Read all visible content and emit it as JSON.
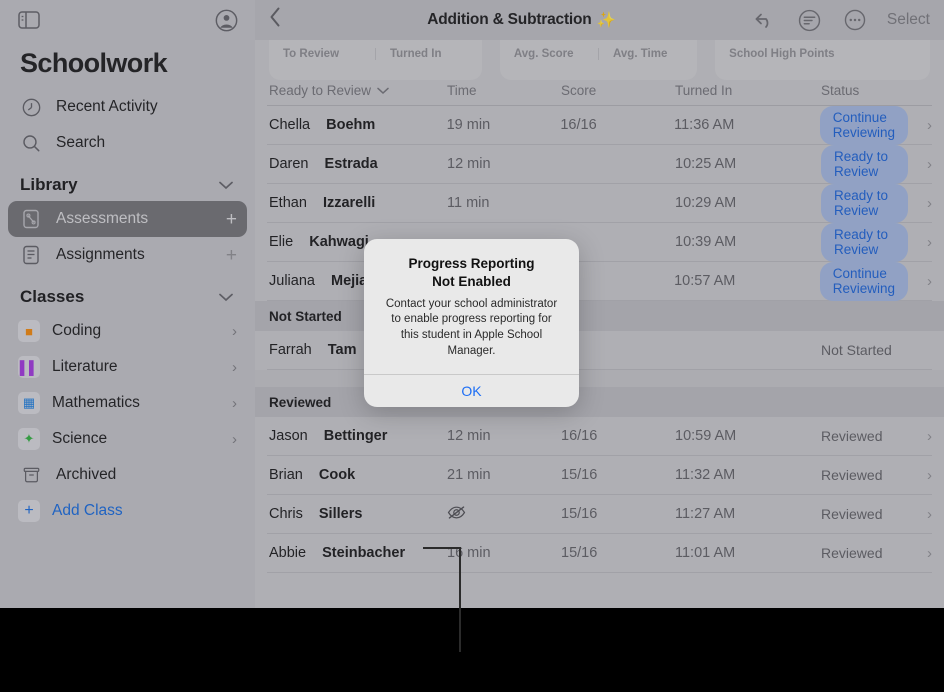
{
  "sidebar": {
    "panel_toggle_icon": "sidebar-toggle-icon",
    "account_icon": "account-circle-icon",
    "app_title": "Schoolwork",
    "quick_items": [
      {
        "label": "Recent Activity",
        "icon": "clock-icon"
      },
      {
        "label": "Search",
        "icon": "search-icon"
      }
    ],
    "library": {
      "header": "Library",
      "collapse_icon": "chevron-down-icon",
      "items": [
        {
          "label": "Assessments",
          "icon": "assessment-doc-icon",
          "selected": true,
          "action": "+"
        },
        {
          "label": "Assignments",
          "icon": "assignment-doc-icon",
          "selected": false,
          "action": "+"
        }
      ]
    },
    "classes": {
      "header": "Classes",
      "collapse_icon": "chevron-down-icon",
      "items": [
        {
          "label": "Coding",
          "icon": "coding-app-icon",
          "glyph": "📙",
          "color": "#e8820c",
          "chevron": true
        },
        {
          "label": "Literature",
          "icon": "literature-app-icon",
          "glyph": "📖",
          "color": "#9b35d6",
          "chevron": true
        },
        {
          "label": "Mathematics",
          "icon": "mathematics-app-icon",
          "glyph": "🧮",
          "color": "#1a78d6",
          "chevron": true
        },
        {
          "label": "Science",
          "icon": "science-app-icon",
          "glyph": "⚛",
          "color": "#2fa83f",
          "chevron": true
        },
        {
          "label": "Archived",
          "icon": "archive-box-icon",
          "glyph": "",
          "color": "#6e6e73",
          "chevron": false
        }
      ],
      "add_class": {
        "label": "Add Class",
        "icon": "plus-square-icon"
      }
    }
  },
  "topbar": {
    "back_icon": "chevron-left-icon",
    "title": "Addition & Subtraction",
    "title_emoji": "✨",
    "undo_icon": "undo-arrow-icon",
    "filter_icon": "filter-circle-icon",
    "more_icon": "more-ellipsis-circle-icon",
    "select_label": "Select"
  },
  "stat_cards": [
    {
      "cells": [
        "To Review",
        "Turned In"
      ]
    },
    {
      "cells": [
        "Avg. Score",
        "Avg. Time"
      ]
    },
    {
      "cells": [
        "School High Points"
      ]
    }
  ],
  "table": {
    "columns": {
      "name": "Ready to Review",
      "name_sort_icon": "chevron-down-icon",
      "time": "Time",
      "score": "Score",
      "turned_in": "Turned In",
      "status": "Status"
    },
    "sections": [
      {
        "header": null,
        "rows": [
          {
            "first": "Chella",
            "last": "Boehm",
            "time": "19 min",
            "score": "16/16",
            "turned_in": "11:36 AM",
            "status": "Continue Reviewing",
            "status_type": "pill",
            "chevron": "›"
          },
          {
            "first": "Daren",
            "last": "Estrada",
            "time": "12 min",
            "score": "",
            "turned_in": "10:25 AM",
            "status": "Ready to Review",
            "status_type": "pill",
            "chevron": "›"
          },
          {
            "first": "Ethan",
            "last": "Izzarelli",
            "time": "11 min",
            "score": "",
            "turned_in": "10:29 AM",
            "status": "Ready to Review",
            "status_type": "pill",
            "chevron": "›"
          },
          {
            "first": "Elie",
            "last": "Kahwagi",
            "time": "",
            "score": "",
            "turned_in": "10:39 AM",
            "status": "Ready to Review",
            "status_type": "pill",
            "chevron": "›"
          },
          {
            "first": "Juliana",
            "last": "Mejia",
            "time": "",
            "score": "",
            "turned_in": "10:57 AM",
            "status": "Continue Reviewing",
            "status_type": "pill",
            "chevron": "›"
          }
        ]
      },
      {
        "header": "Not Started",
        "rows": [
          {
            "first": "Farrah",
            "last": "Tam",
            "time": "",
            "score": "",
            "turned_in": "",
            "status": "Not Started",
            "status_type": "plain",
            "chevron": ""
          }
        ]
      },
      {
        "header": "Reviewed",
        "rows": [
          {
            "first": "Jason",
            "last": "Bettinger",
            "time": "12 min",
            "score": "16/16",
            "turned_in": "10:59 AM",
            "status": "Reviewed",
            "status_type": "plain",
            "chevron": "›"
          },
          {
            "first": "Brian",
            "last": "Cook",
            "time": "21 min",
            "score": "15/16",
            "turned_in": "11:32 AM",
            "status": "Reviewed",
            "status_type": "plain",
            "chevron": "›"
          },
          {
            "first": "Chris",
            "last": "Sillers",
            "time": "",
            "time_icon": "eye-slash-icon",
            "score": "15/16",
            "turned_in": "11:27 AM",
            "status": "Reviewed",
            "status_type": "plain",
            "chevron": "›"
          },
          {
            "first": "Abbie",
            "last": "Steinbacher",
            "time": "16 min",
            "score": "15/16",
            "turned_in": "11:01 AM",
            "status": "Reviewed",
            "status_type": "plain",
            "chevron": "›"
          }
        ]
      }
    ]
  },
  "modal": {
    "title_line1": "Progress Reporting",
    "title_line2": "Not Enabled",
    "message": "Contact your school administrator to enable progress reporting for this student in Apple School Manager.",
    "ok_label": "OK"
  },
  "colors": {
    "accent_blue": "#1a5fd0",
    "pill_bg": "#9cb0d8",
    "link_blue": "#1566d6",
    "page_bg": "#c0c0c5",
    "sidebar_bg": "#babac0"
  }
}
